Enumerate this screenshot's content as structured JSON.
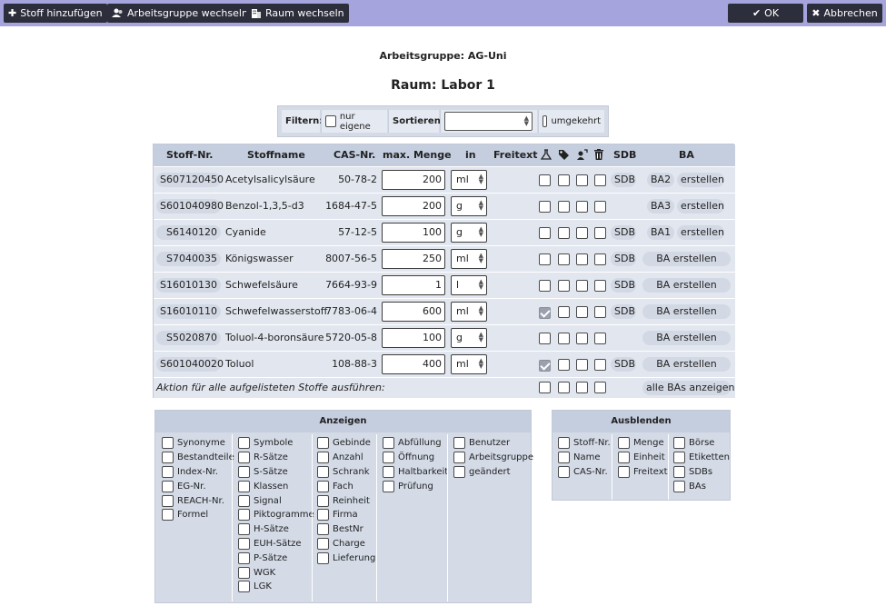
{
  "toolbar": {
    "add_label": "Stoff hinzufügen",
    "group_label": "Arbeitsgruppe wechseln",
    "room_label": "Raum wechseln",
    "ok_label": "OK",
    "cancel_label": "Abbrechen"
  },
  "header": {
    "group": "Arbeitsgruppe: AG-Uni",
    "room": "Raum: Labor 1"
  },
  "filter": {
    "filter_label": "Filtern:",
    "own_label": "nur eigene",
    "sort_label": "Sortieren:",
    "sort_value": "",
    "reverse_label": "umgekehrt"
  },
  "table": {
    "headers": {
      "nr": "Stoff-Nr.",
      "name": "Stoffname",
      "cas": "CAS-Nr.",
      "menge": "max. Menge",
      "in": "in",
      "freitext": "Freitext",
      "sdb": "SDB",
      "ba": "BA"
    },
    "rows": [
      {
        "nr": "S607120450",
        "name": "Acetylsalicylsäure",
        "cas": "50-78-2",
        "menge": "200",
        "unit": "ml",
        "c1": false,
        "sdb": "SDB",
        "ba_code": "BA2",
        "ba_btn": "erstellen"
      },
      {
        "nr": "S601040980",
        "name": "Benzol-1,3,5-d3",
        "cas": "1684-47-5",
        "menge": "200",
        "unit": "g",
        "c1": false,
        "sdb": "",
        "ba_code": "BA3",
        "ba_btn": "erstellen"
      },
      {
        "nr": "S6140120",
        "name": "Cyanide",
        "cas": "57-12-5",
        "menge": "100",
        "unit": "g",
        "c1": false,
        "sdb": "SDB",
        "ba_code": "BA1",
        "ba_btn": "erstellen"
      },
      {
        "nr": "S7040035",
        "name": "Königswasser",
        "cas": "8007-56-5",
        "menge": "250",
        "unit": "ml",
        "c1": false,
        "sdb": "SDB",
        "ba_code": "",
        "ba_btn": "BA erstellen"
      },
      {
        "nr": "S16010130",
        "name": "Schwefelsäure",
        "cas": "7664-93-9",
        "menge": "1",
        "unit": "l",
        "c1": false,
        "sdb": "SDB",
        "ba_code": "",
        "ba_btn": "BA erstellen"
      },
      {
        "nr": "S16010110",
        "name": "Schwefelwasserstoff",
        "cas": "7783-06-4",
        "menge": "600",
        "unit": "ml",
        "c1": true,
        "sdb": "SDB",
        "ba_code": "",
        "ba_btn": "BA erstellen"
      },
      {
        "nr": "S5020870",
        "name": "Toluol-4-boronsäure",
        "cas": "5720-05-8",
        "menge": "100",
        "unit": "g",
        "c1": false,
        "sdb": "",
        "ba_code": "",
        "ba_btn": "BA erstellen"
      },
      {
        "nr": "S601040020",
        "name": "Toluol",
        "cas": "108-88-3",
        "menge": "400",
        "unit": "ml",
        "c1": true,
        "sdb": "SDB",
        "ba_code": "",
        "ba_btn": "BA erstellen"
      }
    ],
    "footer_text": "Aktion für alle aufgelisteten Stoffe ausführen:",
    "footer_btn": "alle BAs anzeigen"
  },
  "anzeigen": {
    "title": "Anzeigen",
    "columns": [
      [
        "Synonyme",
        "Bestandteile",
        "Index-Nr.",
        "EG-Nr.",
        "REACH-Nr.",
        "Formel"
      ],
      [
        "Symbole",
        "R-Sätze",
        "S-Sätze",
        "Klassen",
        "Signal",
        "Piktogramme",
        "H-Sätze",
        "EUH-Sätze",
        "P-Sätze",
        "WGK",
        "LGK"
      ],
      [
        "Gebinde",
        "Anzahl",
        "Schrank",
        "Fach",
        "Reinheit",
        "Firma",
        "BestNr",
        "Charge",
        "Lieferung"
      ],
      [
        "Abfüllung",
        "Öffnung",
        "Haltbarkeit",
        "Prüfung"
      ],
      [
        "Benutzer",
        "Arbeitsgruppe",
        "geändert"
      ]
    ]
  },
  "ausblenden": {
    "title": "Ausblenden",
    "columns": [
      [
        "Stoff-Nr.",
        "Name",
        "CAS-Nr."
      ],
      [
        "Menge",
        "Einheit",
        "Freitext"
      ],
      [
        "Börse",
        "Etiketten",
        "SDBs",
        "BAs"
      ]
    ]
  }
}
